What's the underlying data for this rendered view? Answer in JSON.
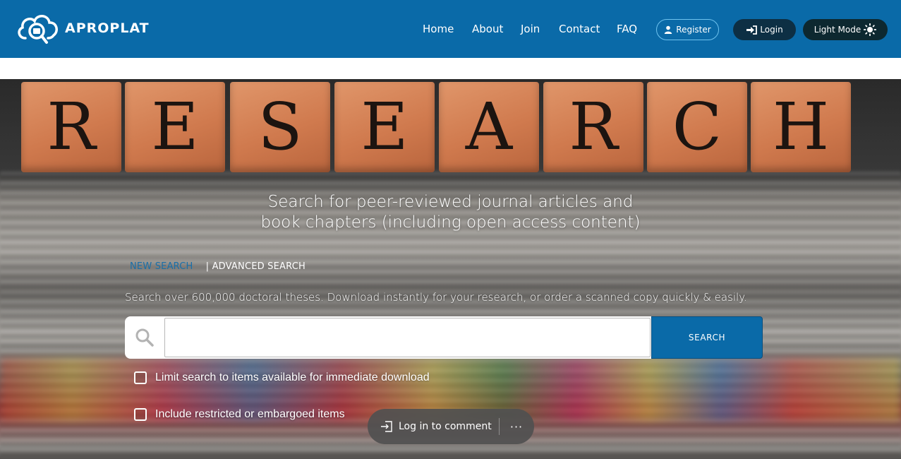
{
  "brand": {
    "name": "APROPLAT"
  },
  "nav": {
    "links": [
      {
        "label": "Home"
      },
      {
        "label": "About"
      },
      {
        "label": "Join"
      },
      {
        "label": "Contact"
      },
      {
        "label": "FAQ"
      }
    ],
    "register_label": "Register",
    "login_label": "Login",
    "mode_label": "Light Mode"
  },
  "hero": {
    "tiles": [
      "R",
      "E",
      "S",
      "E",
      "A",
      "R",
      "C",
      "H"
    ],
    "title_line1": "Search for peer-reviewed journal articles and",
    "title_line2": "book chapters (including open access content)"
  },
  "search": {
    "tab_new": "NEW SEARCH",
    "tab_advanced": "| ADVANCED SEARCH",
    "intro": "Search over 600,000 doctoral theses. Download instantly for your research, or order a scanned copy quickly & easily.",
    "input_value": "",
    "button_label": "SEARCH",
    "options": [
      {
        "label": "Limit search to items available for immediate download",
        "checked": false
      },
      {
        "label": "Include restricted or embargoed items",
        "checked": false
      }
    ]
  },
  "comment_bar": {
    "login_label": "Log in to comment",
    "more_label": "···"
  },
  "colors": {
    "header": "#0a6aa8",
    "button_dark": "#0d2f44",
    "accent_link": "#1a6fa8"
  }
}
